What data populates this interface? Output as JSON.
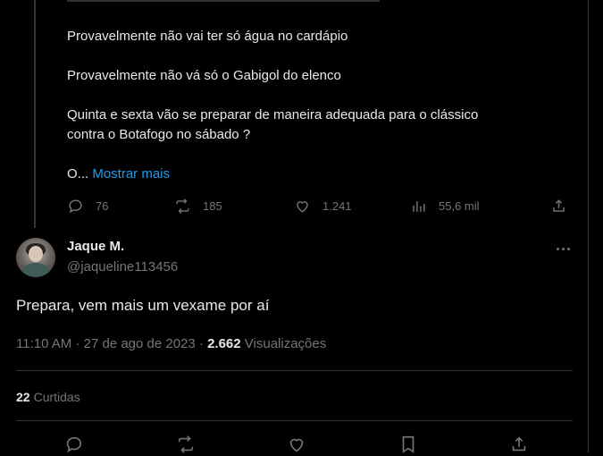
{
  "quoted_tweet": {
    "paragraphs": [
      "Provavelmente não vai ter só água no cardápio",
      "Provavelmente não vá só o Gabigol do elenco",
      "Quinta e sexta vão se preparar de maneira adequada para o clássico\ncontra o Botafogo no sábado ?"
    ],
    "truncated_prefix": "O...",
    "show_more_label": "Mostrar mais",
    "actions": {
      "reply_icon": "reply-icon",
      "replies": "76",
      "retweet_icon": "retweet-icon",
      "retweets": "185",
      "like_icon": "like-icon",
      "likes": "1.241",
      "views_icon": "views-icon",
      "views": "55,6 mil",
      "share_icon": "share-icon"
    }
  },
  "reply_tweet": {
    "author_name": "Jaque M.",
    "author_handle": "@jaqueline113456",
    "text": "Prepara, vem mais um vexame por aí",
    "time": "11:10 AM",
    "date": "27 de ago de 2023",
    "views_count": "2.662",
    "views_label": "Visualizações",
    "likes_count": "22",
    "likes_label": "Curtidas"
  },
  "colors": {
    "background": "#000000",
    "text_primary": "#e7e9ea",
    "text_secondary": "#71767b",
    "link": "#1d9bf0",
    "border": "#2f3336"
  }
}
